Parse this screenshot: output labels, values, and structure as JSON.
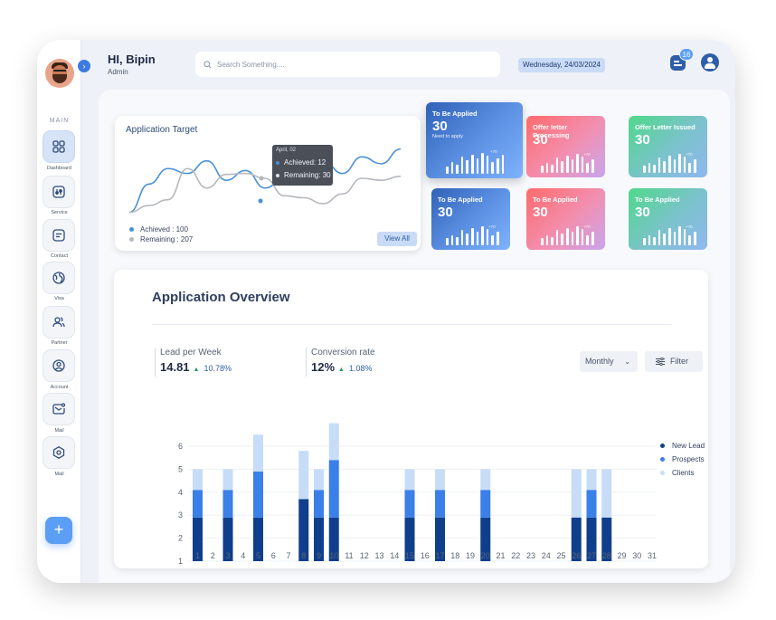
{
  "header": {
    "greeting": "HI, Bipin",
    "role": "Admin",
    "search_placeholder": "Search Something....",
    "date": "Wednesday, 24/03/2024",
    "notification_count": "16"
  },
  "sidebar": {
    "section_label": "MAIN",
    "items": [
      {
        "label": "Dashboard",
        "icon": "grid-icon",
        "active": true
      },
      {
        "label": "Service",
        "icon": "service-icon",
        "active": false
      },
      {
        "label": "Contact",
        "icon": "contact-icon",
        "active": false
      },
      {
        "label": "Visa",
        "icon": "globe-icon",
        "active": false
      },
      {
        "label": "Partner",
        "icon": "partner-icon",
        "active": false
      },
      {
        "label": "Account",
        "icon": "account-icon",
        "active": false
      },
      {
        "label": "Mail",
        "icon": "mail-icon",
        "active": false
      },
      {
        "label": "Mail",
        "icon": "settings-icon",
        "active": false
      }
    ],
    "add_label": "+"
  },
  "target": {
    "title": "Application Target",
    "achieved_label": "Achieved : 100",
    "remaining_label": "Remaining : 207",
    "view_all": "View All",
    "tooltip": {
      "date": "April, 02",
      "achieved": "Achieved: 12",
      "remaining": "Remaining: 30"
    },
    "colors": {
      "achieved": "#4a90d9",
      "remaining": "#b5b8bd"
    }
  },
  "stats": [
    {
      "title": "To Be Applied",
      "value": "30",
      "sub": "Need to apply",
      "delta": "+70",
      "theme": "blue"
    },
    {
      "title": "Offer letter Processing",
      "value": "30",
      "sub": "",
      "delta": "+70",
      "theme": "red"
    },
    {
      "title": "Offer Letter Issued",
      "value": "30",
      "sub": "",
      "delta": "+70",
      "theme": "green"
    },
    {
      "title": "To Be Applied",
      "value": "30",
      "sub": "",
      "delta": "+70",
      "theme": "blue"
    },
    {
      "title": "To Be Applied",
      "value": "30",
      "sub": "",
      "delta": "+70",
      "theme": "red"
    },
    {
      "title": "To Be Applied",
      "value": "30",
      "sub": "",
      "delta": "+70",
      "theme": "green"
    }
  ],
  "overview": {
    "title": "Application Overview",
    "lead": {
      "label": "Lead per Week",
      "value": "14.81",
      "delta": "10.78%"
    },
    "conversion": {
      "label": "Conversion rate",
      "value": "12%",
      "delta": "1.08%"
    },
    "period": "Monthly",
    "filter_label": "Filter"
  },
  "chart_data": {
    "type": "bar",
    "stacked": true,
    "categories": [
      "1",
      "2",
      "3",
      "4",
      "5",
      "6",
      "7",
      "8",
      "9",
      "10",
      "11",
      "12",
      "13",
      "14",
      "15",
      "16",
      "17",
      "18",
      "19",
      "20",
      "21",
      "22",
      "23",
      "24",
      "25",
      "26",
      "27",
      "28",
      "29",
      "30",
      "31"
    ],
    "ylim": [
      1,
      6
    ],
    "yticks": [
      1,
      2,
      3,
      4,
      5,
      6
    ],
    "legend_position": "top-right",
    "series": [
      {
        "name": "New Lead",
        "color": "#0f3f8c",
        "values": [
          1.9,
          0,
          1.9,
          0,
          1.9,
          0,
          0,
          2.7,
          1.9,
          1.9,
          0,
          0,
          0,
          0,
          1.9,
          0,
          1.9,
          0,
          0,
          1.9,
          0,
          0,
          0,
          0,
          0,
          1.9,
          1.9,
          1.9,
          0,
          0,
          0
        ]
      },
      {
        "name": "Prospects",
        "color": "#3b7fe8",
        "values": [
          1.2,
          0,
          1.2,
          0,
          2.0,
          0,
          0,
          0,
          1.2,
          2.5,
          0,
          0,
          0,
          0,
          1.2,
          0,
          1.2,
          0,
          0,
          1.2,
          0,
          0,
          0,
          0,
          0,
          0,
          1.2,
          0,
          0,
          0,
          0
        ]
      },
      {
        "name": "Clients",
        "color": "#c7dcf7",
        "values": [
          0.9,
          0,
          0.9,
          0,
          1.6,
          0,
          0,
          2.1,
          0.9,
          1.6,
          0,
          0,
          0,
          0,
          0.9,
          0,
          0.9,
          0,
          0,
          0.9,
          0,
          0,
          0,
          0,
          0,
          2.1,
          0.9,
          2.1,
          0,
          0,
          0
        ]
      }
    ]
  },
  "target_chart": {
    "type": "line",
    "series": [
      {
        "name": "Achieved",
        "values": [
          5,
          34,
          50,
          45,
          58,
          38,
          48,
          30,
          40,
          60,
          58,
          45,
          62,
          55,
          70
        ]
      },
      {
        "name": "Remaining",
        "values": [
          5,
          12,
          18,
          50,
          30,
          44,
          45,
          40,
          22,
          20,
          14,
          24,
          40,
          38,
          42
        ]
      }
    ]
  }
}
